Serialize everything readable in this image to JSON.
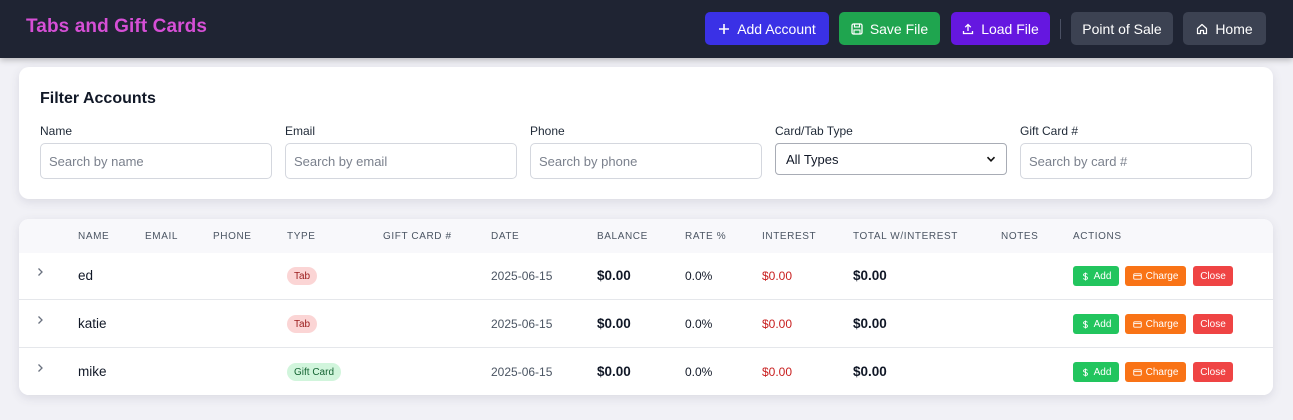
{
  "header": {
    "title": "Tabs and Gift Cards",
    "title_color": "#d64fd6",
    "buttons": {
      "add_account": "Add Account",
      "save_file": "Save File",
      "load_file": "Load File",
      "point_of_sale": "Point of Sale",
      "home": "Home"
    }
  },
  "filter": {
    "title": "Filter Accounts",
    "name": {
      "label": "Name",
      "placeholder": "Search by name",
      "value": ""
    },
    "email": {
      "label": "Email",
      "placeholder": "Search by email",
      "value": ""
    },
    "phone": {
      "label": "Phone",
      "placeholder": "Search by phone",
      "value": ""
    },
    "type": {
      "label": "Card/Tab Type",
      "selected": "All Types"
    },
    "gift_card": {
      "label": "Gift Card #",
      "placeholder": "Search by card #",
      "value": ""
    }
  },
  "table": {
    "columns": {
      "name": "Name",
      "email": "Email",
      "phone": "Phone",
      "type": "Type",
      "gift_card": "Gift Card #",
      "date": "Date",
      "balance": "Balance",
      "rate": "Rate %",
      "interest": "Interest",
      "total": "Total w/Interest",
      "notes": "Notes",
      "actions": "Actions"
    },
    "action_labels": {
      "add": "Add",
      "charge": "Charge",
      "close": "Close"
    },
    "rows": [
      {
        "name": "ed",
        "email": "",
        "phone": "",
        "type": "Tab",
        "gift_card": "",
        "date": "2025-06-15",
        "balance": "$0.00",
        "rate": "0.0%",
        "interest": "$0.00",
        "total": "$0.00",
        "notes": ""
      },
      {
        "name": "katie",
        "email": "",
        "phone": "",
        "type": "Tab",
        "gift_card": "",
        "date": "2025-06-15",
        "balance": "$0.00",
        "rate": "0.0%",
        "interest": "$0.00",
        "total": "$0.00",
        "notes": ""
      },
      {
        "name": "mike",
        "email": "",
        "phone": "",
        "type": "Gift Card",
        "gift_card": "",
        "date": "2025-06-15",
        "balance": "$0.00",
        "rate": "0.0%",
        "interest": "$0.00",
        "total": "$0.00",
        "notes": ""
      }
    ]
  },
  "colors": {
    "header_bg": "#1f2433",
    "add_account": "#3a31e6",
    "save_file": "#1fa54f",
    "load_file": "#6517e0",
    "neutral_button": "#3c4252",
    "action_add": "#22c55e",
    "action_charge": "#f97316",
    "action_close": "#ef4444"
  }
}
